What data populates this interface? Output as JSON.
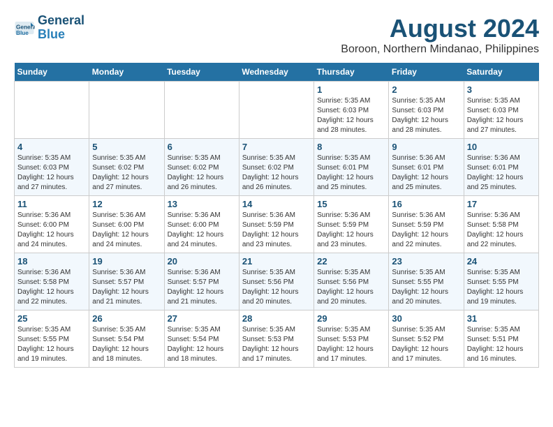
{
  "header": {
    "logo_line1": "General",
    "logo_line2": "Blue",
    "month": "August 2024",
    "location": "Boroon, Northern Mindanao, Philippines"
  },
  "weekdays": [
    "Sunday",
    "Monday",
    "Tuesday",
    "Wednesday",
    "Thursday",
    "Friday",
    "Saturday"
  ],
  "weeks": [
    [
      {
        "day": "",
        "info": ""
      },
      {
        "day": "",
        "info": ""
      },
      {
        "day": "",
        "info": ""
      },
      {
        "day": "",
        "info": ""
      },
      {
        "day": "1",
        "info": "Sunrise: 5:35 AM\nSunset: 6:03 PM\nDaylight: 12 hours\nand 28 minutes."
      },
      {
        "day": "2",
        "info": "Sunrise: 5:35 AM\nSunset: 6:03 PM\nDaylight: 12 hours\nand 28 minutes."
      },
      {
        "day": "3",
        "info": "Sunrise: 5:35 AM\nSunset: 6:03 PM\nDaylight: 12 hours\nand 27 minutes."
      }
    ],
    [
      {
        "day": "4",
        "info": "Sunrise: 5:35 AM\nSunset: 6:03 PM\nDaylight: 12 hours\nand 27 minutes."
      },
      {
        "day": "5",
        "info": "Sunrise: 5:35 AM\nSunset: 6:02 PM\nDaylight: 12 hours\nand 27 minutes."
      },
      {
        "day": "6",
        "info": "Sunrise: 5:35 AM\nSunset: 6:02 PM\nDaylight: 12 hours\nand 26 minutes."
      },
      {
        "day": "7",
        "info": "Sunrise: 5:35 AM\nSunset: 6:02 PM\nDaylight: 12 hours\nand 26 minutes."
      },
      {
        "day": "8",
        "info": "Sunrise: 5:35 AM\nSunset: 6:01 PM\nDaylight: 12 hours\nand 25 minutes."
      },
      {
        "day": "9",
        "info": "Sunrise: 5:36 AM\nSunset: 6:01 PM\nDaylight: 12 hours\nand 25 minutes."
      },
      {
        "day": "10",
        "info": "Sunrise: 5:36 AM\nSunset: 6:01 PM\nDaylight: 12 hours\nand 25 minutes."
      }
    ],
    [
      {
        "day": "11",
        "info": "Sunrise: 5:36 AM\nSunset: 6:00 PM\nDaylight: 12 hours\nand 24 minutes."
      },
      {
        "day": "12",
        "info": "Sunrise: 5:36 AM\nSunset: 6:00 PM\nDaylight: 12 hours\nand 24 minutes."
      },
      {
        "day": "13",
        "info": "Sunrise: 5:36 AM\nSunset: 6:00 PM\nDaylight: 12 hours\nand 24 minutes."
      },
      {
        "day": "14",
        "info": "Sunrise: 5:36 AM\nSunset: 5:59 PM\nDaylight: 12 hours\nand 23 minutes."
      },
      {
        "day": "15",
        "info": "Sunrise: 5:36 AM\nSunset: 5:59 PM\nDaylight: 12 hours\nand 23 minutes."
      },
      {
        "day": "16",
        "info": "Sunrise: 5:36 AM\nSunset: 5:59 PM\nDaylight: 12 hours\nand 22 minutes."
      },
      {
        "day": "17",
        "info": "Sunrise: 5:36 AM\nSunset: 5:58 PM\nDaylight: 12 hours\nand 22 minutes."
      }
    ],
    [
      {
        "day": "18",
        "info": "Sunrise: 5:36 AM\nSunset: 5:58 PM\nDaylight: 12 hours\nand 22 minutes."
      },
      {
        "day": "19",
        "info": "Sunrise: 5:36 AM\nSunset: 5:57 PM\nDaylight: 12 hours\nand 21 minutes."
      },
      {
        "day": "20",
        "info": "Sunrise: 5:36 AM\nSunset: 5:57 PM\nDaylight: 12 hours\nand 21 minutes."
      },
      {
        "day": "21",
        "info": "Sunrise: 5:35 AM\nSunset: 5:56 PM\nDaylight: 12 hours\nand 20 minutes."
      },
      {
        "day": "22",
        "info": "Sunrise: 5:35 AM\nSunset: 5:56 PM\nDaylight: 12 hours\nand 20 minutes."
      },
      {
        "day": "23",
        "info": "Sunrise: 5:35 AM\nSunset: 5:55 PM\nDaylight: 12 hours\nand 20 minutes."
      },
      {
        "day": "24",
        "info": "Sunrise: 5:35 AM\nSunset: 5:55 PM\nDaylight: 12 hours\nand 19 minutes."
      }
    ],
    [
      {
        "day": "25",
        "info": "Sunrise: 5:35 AM\nSunset: 5:55 PM\nDaylight: 12 hours\nand 19 minutes."
      },
      {
        "day": "26",
        "info": "Sunrise: 5:35 AM\nSunset: 5:54 PM\nDaylight: 12 hours\nand 18 minutes."
      },
      {
        "day": "27",
        "info": "Sunrise: 5:35 AM\nSunset: 5:54 PM\nDaylight: 12 hours\nand 18 minutes."
      },
      {
        "day": "28",
        "info": "Sunrise: 5:35 AM\nSunset: 5:53 PM\nDaylight: 12 hours\nand 17 minutes."
      },
      {
        "day": "29",
        "info": "Sunrise: 5:35 AM\nSunset: 5:53 PM\nDaylight: 12 hours\nand 17 minutes."
      },
      {
        "day": "30",
        "info": "Sunrise: 5:35 AM\nSunset: 5:52 PM\nDaylight: 12 hours\nand 17 minutes."
      },
      {
        "day": "31",
        "info": "Sunrise: 5:35 AM\nSunset: 5:51 PM\nDaylight: 12 hours\nand 16 minutes."
      }
    ]
  ]
}
